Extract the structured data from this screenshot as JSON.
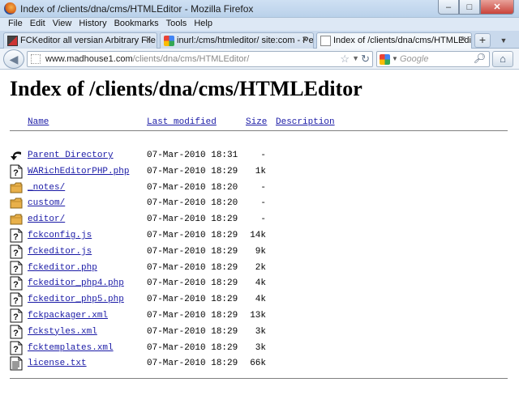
{
  "window": {
    "title": "Index of /clients/dna/cms/HTMLEditor - Mozilla Firefox",
    "minimize": "–",
    "maximize": "□",
    "close": "✕"
  },
  "menu": [
    "File",
    "Edit",
    "View",
    "History",
    "Bookmarks",
    "Tools",
    "Help"
  ],
  "tabs": [
    {
      "label": "FCKeditor all versian Arbitrary File Upl...",
      "icon": "fckeditor-favicon",
      "active": false
    },
    {
      "label": "inurl:/cms/htmleditor/ site:com - Pe...",
      "icon": "google-favicon",
      "active": false
    },
    {
      "label": "Index of /clients/dna/cms/HTMLEditor",
      "icon": "page-favicon",
      "active": true
    }
  ],
  "newtab_label": "+",
  "navbar": {
    "back": "◀",
    "url_domain": "www.madhouse1.com",
    "url_path": "/clients/dna/cms/HTMLEditor/",
    "search_placeholder": "Google",
    "home": "⌂"
  },
  "page": {
    "title": "Index of /clients/dna/cms/HTMLEditor",
    "columns": {
      "name": "Name",
      "modified": "Last modified",
      "size": "Size",
      "description": "Description"
    },
    "entries": [
      {
        "name": "Parent Directory",
        "modified": "07-Mar-2010 18:31",
        "size": "-",
        "icon": "back-icon"
      },
      {
        "name": "WARichEditorPHP.php",
        "modified": "07-Mar-2010 18:29",
        "size": "1k",
        "icon": "unknown-file-icon"
      },
      {
        "name": "_notes/",
        "modified": "07-Mar-2010 18:20",
        "size": "-",
        "icon": "folder-icon"
      },
      {
        "name": "custom/",
        "modified": "07-Mar-2010 18:20",
        "size": "-",
        "icon": "folder-icon"
      },
      {
        "name": "editor/",
        "modified": "07-Mar-2010 18:29",
        "size": "-",
        "icon": "folder-icon"
      },
      {
        "name": "fckconfig.js",
        "modified": "07-Mar-2010 18:29",
        "size": "14k",
        "icon": "unknown-file-icon"
      },
      {
        "name": "fckeditor.js",
        "modified": "07-Mar-2010 18:29",
        "size": "9k",
        "icon": "unknown-file-icon"
      },
      {
        "name": "fckeditor.php",
        "modified": "07-Mar-2010 18:29",
        "size": "2k",
        "icon": "unknown-file-icon"
      },
      {
        "name": "fckeditor_php4.php",
        "modified": "07-Mar-2010 18:29",
        "size": "4k",
        "icon": "unknown-file-icon"
      },
      {
        "name": "fckeditor_php5.php",
        "modified": "07-Mar-2010 18:29",
        "size": "4k",
        "icon": "unknown-file-icon"
      },
      {
        "name": "fckpackager.xml",
        "modified": "07-Mar-2010 18:29",
        "size": "13k",
        "icon": "unknown-file-icon"
      },
      {
        "name": "fckstyles.xml",
        "modified": "07-Mar-2010 18:29",
        "size": "3k",
        "icon": "unknown-file-icon"
      },
      {
        "name": "fcktemplates.xml",
        "modified": "07-Mar-2010 18:29",
        "size": "3k",
        "icon": "unknown-file-icon"
      },
      {
        "name": "license.txt",
        "modified": "07-Mar-2010 18:29",
        "size": "66k",
        "icon": "text-file-icon"
      }
    ]
  },
  "colors": {
    "link": "#1a1aa6",
    "folder": "#e8b04a",
    "chrome": "#dde8f5"
  }
}
